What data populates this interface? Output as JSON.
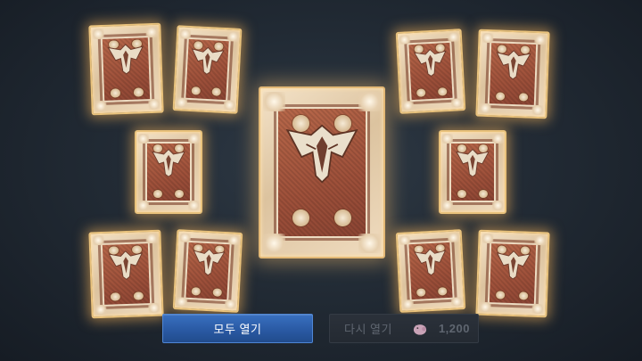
{
  "buttons": {
    "open_all_label": "모두 열기",
    "reopen_label": "다시 열기",
    "reopen_cost": "1,200",
    "reopen_cost_icon": "pig-currency-icon",
    "reopen_enabled": false
  },
  "cards": {
    "count": 11,
    "back_icon": "winged-helm-crest-icon",
    "colors": {
      "frame": "#e9c27c",
      "panel": "#b8684a",
      "glow": "#ffb85a"
    }
  },
  "colors": {
    "background": "#222b35",
    "primary_button": "#2a5aa4",
    "disabled_button": "#2b313a"
  }
}
